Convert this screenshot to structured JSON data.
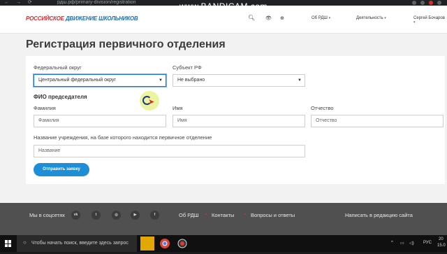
{
  "browser": {
    "url": "рдш.рф/primary-division/registration",
    "watermark": "www.BANDICAM.com"
  },
  "header": {
    "logo_part1": "РОССИЙСКОЕ",
    "logo_part2": "ДВИЖЕНИЕ ШКОЛЬНИКОВ",
    "links": {
      "about": "Об РДШ",
      "activity": "Деятельность",
      "user": "Сергей Бочаров"
    },
    "icons": [
      "search-icon",
      "accessibility-icon",
      "globe-icon"
    ]
  },
  "main": {
    "title": "Регистрация первичного отделения",
    "federal_district": {
      "label": "Федеральный округ",
      "value": "Центральный федеральный округ"
    },
    "subject": {
      "label": "Субъект РФ",
      "value": "Не выбрано"
    },
    "chair_section": "ФИО председателя",
    "last_name": {
      "label": "Фамилия",
      "placeholder": "Фамилия"
    },
    "first_name": {
      "label": "Имя",
      "placeholder": "Имя"
    },
    "patronymic": {
      "label": "Отчество",
      "placeholder": "Отчество"
    },
    "institution": {
      "label": "Название учреждения, на базе которого находится первичное отделение",
      "placeholder": "Название"
    },
    "submit_label": "Отправить заявку"
  },
  "footer": {
    "social_label": "Мы в соцсетях",
    "social_icons": [
      {
        "name": "vk-icon",
        "glyph": "vk"
      },
      {
        "name": "twitter-icon",
        "glyph": "t"
      },
      {
        "name": "instagram-icon",
        "glyph": "◎"
      },
      {
        "name": "youtube-icon",
        "glyph": "▶"
      },
      {
        "name": "facebook-icon",
        "glyph": "f"
      }
    ],
    "links": [
      "Об РДШ",
      "Контакты",
      "Вопросы и ответы"
    ],
    "write_editorial": "Написать в редакцию сайта"
  },
  "taskbar": {
    "search_placeholder": "Чтобы начать поиск, введите здесь запрос",
    "lang": "РУС",
    "time": "20",
    "date": "15.0"
  },
  "colors": {
    "accent": "#1e8fd6",
    "brand_red": "#e5242b",
    "brand_blue": "#1d6fb8",
    "footer_bg": "#505050",
    "page_bg": "#f2f2f2"
  }
}
